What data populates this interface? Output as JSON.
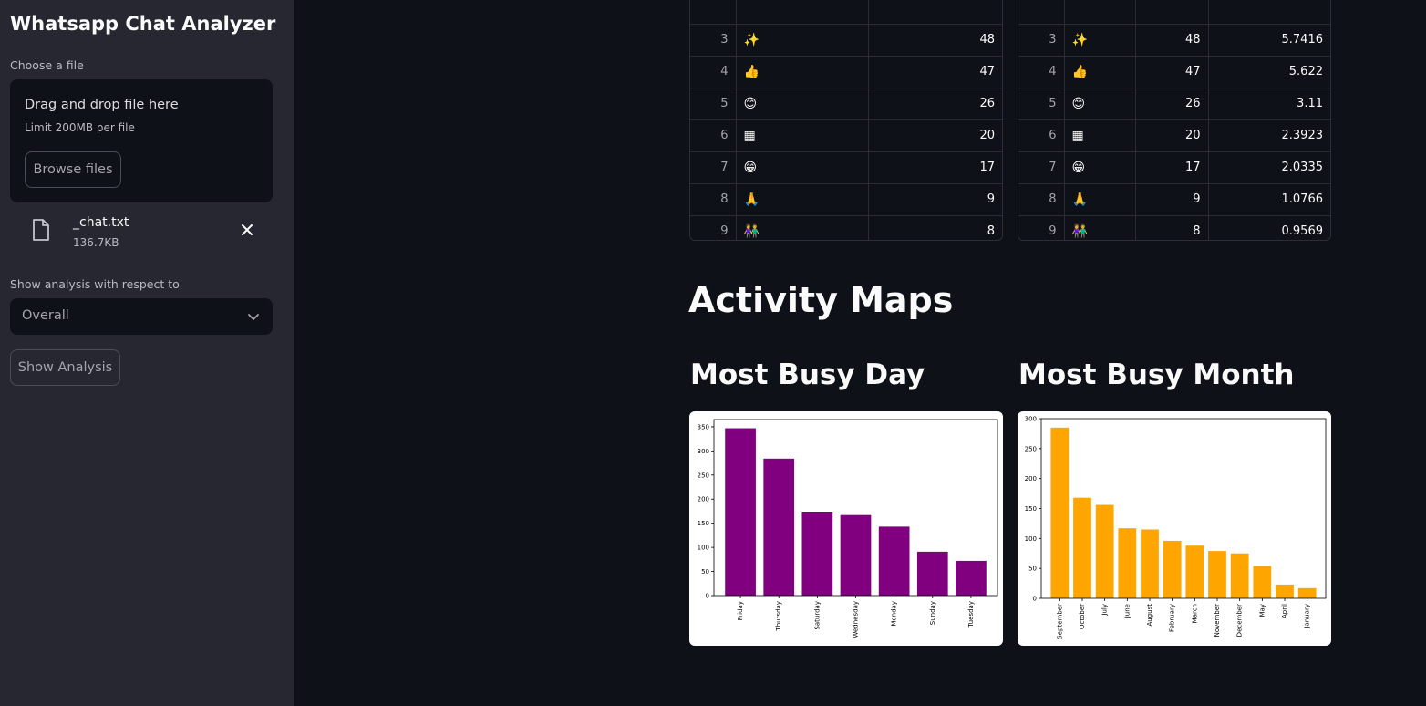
{
  "sidebar": {
    "title": "Whatsapp Chat Analyzer",
    "choose_label": "Choose a file",
    "dropzone_title": "Drag and drop file here",
    "dropzone_limit": "Limit 200MB per file",
    "browse_label": "Browse files",
    "file_name": "_chat.txt",
    "file_size": "136.7KB",
    "respect_label": "Show analysis with respect to",
    "select_value": "Overall",
    "show_button": "Show Analysis"
  },
  "emoji_table_left": {
    "rows": [
      {
        "idx": "3",
        "emoji": "✨",
        "count": "48"
      },
      {
        "idx": "4",
        "emoji": "👍",
        "count": "47"
      },
      {
        "idx": "5",
        "emoji": "😊",
        "count": "26"
      },
      {
        "idx": "6",
        "emoji": "▦",
        "count": "20"
      },
      {
        "idx": "7",
        "emoji": "😁",
        "count": "17"
      },
      {
        "idx": "8",
        "emoji": "🙏",
        "count": "9"
      },
      {
        "idx": "9",
        "emoji": "👫",
        "count": "8"
      }
    ]
  },
  "emoji_table_right": {
    "rows": [
      {
        "idx": "3",
        "emoji": "✨",
        "count": "48",
        "pct": "5.7416"
      },
      {
        "idx": "4",
        "emoji": "👍",
        "count": "47",
        "pct": "5.622"
      },
      {
        "idx": "5",
        "emoji": "😊",
        "count": "26",
        "pct": "3.11"
      },
      {
        "idx": "6",
        "emoji": "▦",
        "count": "20",
        "pct": "2.3923"
      },
      {
        "idx": "7",
        "emoji": "😁",
        "count": "17",
        "pct": "2.0335"
      },
      {
        "idx": "8",
        "emoji": "🙏",
        "count": "9",
        "pct": "1.0766"
      },
      {
        "idx": "9",
        "emoji": "👫",
        "count": "8",
        "pct": "0.9569"
      }
    ]
  },
  "main": {
    "activity_heading": "Activity Maps",
    "busy_day_heading": "Most Busy Day",
    "busy_month_heading": "Most Busy Month"
  },
  "chart_data": [
    {
      "type": "bar",
      "title": "",
      "categories": [
        "Friday",
        "Thursday",
        "Saturday",
        "Wednesday",
        "Monday",
        "Sunday",
        "Tuesday"
      ],
      "values": [
        347,
        284,
        174,
        167,
        143,
        91,
        72
      ],
      "ylim": [
        0,
        365
      ],
      "yticks": [
        0,
        50,
        100,
        150,
        200,
        250,
        300,
        350
      ],
      "color": "#800080"
    },
    {
      "type": "bar",
      "title": "",
      "categories": [
        "September",
        "October",
        "July",
        "June",
        "August",
        "February",
        "March",
        "November",
        "December",
        "May",
        "April",
        "January"
      ],
      "values": [
        285,
        168,
        156,
        117,
        115,
        96,
        88,
        79,
        75,
        54,
        23,
        17
      ],
      "ylim": [
        0,
        300
      ],
      "yticks": [
        0,
        50,
        100,
        150,
        200,
        250,
        300
      ],
      "color": "#ffa500"
    }
  ]
}
